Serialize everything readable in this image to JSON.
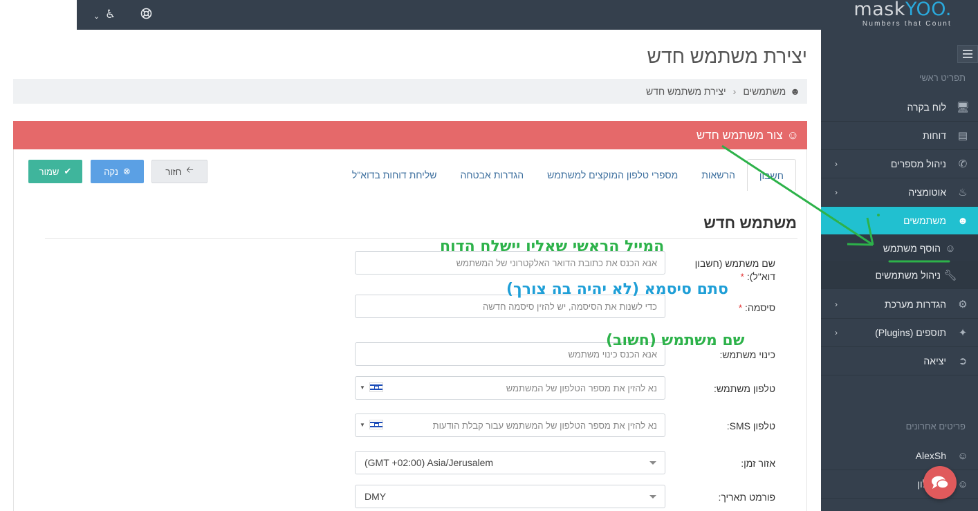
{
  "topbar": {
    "icons": [
      "chevron-down-icon",
      "accessibility-icon",
      "lifebuoy-icon"
    ]
  },
  "logo": {
    "brand_main": "mask",
    "brand_accent": "YOO.",
    "tagline": "Numbers that Count"
  },
  "sidebar": {
    "main_heading": "תפריט ראשי",
    "items": [
      {
        "label": "לוח בקרה",
        "icon": "monitor-icon"
      },
      {
        "label": "דוחות",
        "icon": "bar-chart-icon"
      },
      {
        "label": "ניהול מספרים",
        "icon": "phone-icon"
      },
      {
        "label": "אוטומציה",
        "icon": "bell-icon"
      },
      {
        "label": "משתמשים",
        "icon": "users-icon"
      },
      {
        "label": "הוסף משתמש",
        "icon": "user-icon"
      },
      {
        "label": "ניהול משתמשים",
        "icon": "wrench-icon"
      },
      {
        "label": "הגדרות מערכת",
        "icon": "gear-icon"
      },
      {
        "label": "תוספים (Plugins)",
        "icon": "magic-wand-icon"
      },
      {
        "label": "יציאה",
        "icon": "sign-out-icon"
      }
    ],
    "recent_heading": "פריטים אחרונים",
    "recent": [
      {
        "label": "AlexSh"
      },
      {
        "label": "אשקלון"
      }
    ]
  },
  "page": {
    "title": "יצירת משתמש חדש",
    "breadcrumb": [
      "משתמשים",
      "יצירת משתמש חדש"
    ],
    "panel_title": "צור משתמש חדש"
  },
  "tabs": [
    "חשבון",
    "הרשאות",
    "מספרי טלפון המוקצים למשתמש",
    "הגדרות אבטחה",
    "שליחת דוחות בדוא\"ל"
  ],
  "buttons": {
    "save": "שמור",
    "clear": "נקה",
    "back": "חזור"
  },
  "form": {
    "section_title": "משתמש חדש",
    "email_label": "שם משתמש (חשבון דוא\"ל):",
    "email_placeholder": "אנא הכנס את כתובת הדואר האלקטרוני של המשתמש",
    "password_label": "סיסמה:",
    "password_placeholder": "כדי לשנות את הסיסמה, יש להזין סיסמה חדשה",
    "nickname_label": "כינוי משתמש:",
    "nickname_placeholder": "אנא הכנס כינוי משתמש",
    "phone_label": "טלפון משתמש:",
    "phone_placeholder": "נא להזין את מספר הטלפון של המשתמש",
    "sms_label": "טלפון SMS:",
    "sms_placeholder": "נא להזין את מספר הטלפון של המשתמש עבור קבלת הודעות",
    "timezone_label": "אזור זמן:",
    "timezone_value": "(GMT +02:00) Asia/Jerusalem",
    "dateformat_label": "פורמט תאריך:",
    "dateformat_value": "DMY",
    "required_mark": "*"
  },
  "annotations": {
    "email_note": "המייל הראשי שאליו יישלח הדוח",
    "password_note": "סתם סיסמא (לא יהיה בה צורך)",
    "nickname_note": "שם משתמש (חשוב)"
  },
  "colors": {
    "sidebar_bg": "#35404d",
    "active_item": "#21c0d0",
    "panel_header": "#e5696a",
    "save_btn": "#3fb59c",
    "clear_btn": "#5ba0e4",
    "annotation_green": "#2db24a",
    "annotation_blue": "#1f9fd7"
  }
}
